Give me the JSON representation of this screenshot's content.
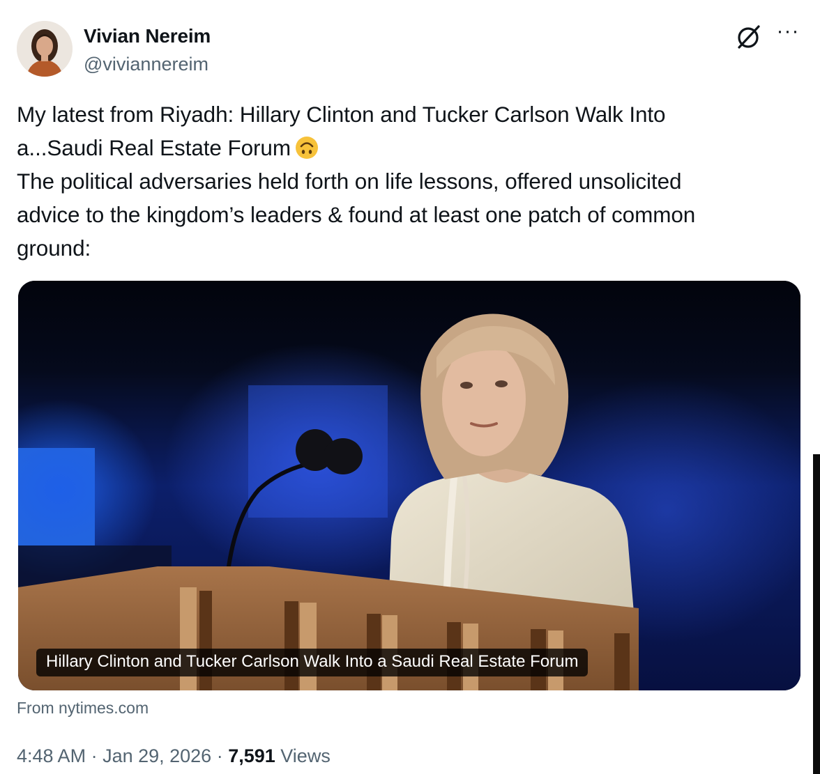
{
  "author": {
    "name": "Vivian Nereim",
    "handle": "@viviannereim"
  },
  "header_icons": {
    "grok": "grok-slash-circle-icon",
    "more": "more-dots-icon",
    "more_glyph": "···"
  },
  "tweet": {
    "lines": [
      "My latest from Riyadh: Hillary Clinton and Tucker Carlson Walk Into",
      "a...Saudi Real Estate Forum",
      "The political adversaries held forth on life lessons, offered unsolicited",
      "advice to the kingdom’s leaders & found at least one patch of common",
      "ground:"
    ],
    "emoji": "upside-down-face-emoji"
  },
  "card": {
    "title": "Hillary Clinton and Tucker Carlson Walk Into a Saudi Real Estate Forum",
    "source": "From nytimes.com"
  },
  "meta": {
    "time": "4:48 AM",
    "separator": " · ",
    "date": "Jan 29, 2026",
    "views_count": "7,591",
    "views_label": " Views"
  },
  "colors": {
    "text": "#0f1419",
    "secondary": "#536471",
    "emoji": "#f7c23a"
  }
}
